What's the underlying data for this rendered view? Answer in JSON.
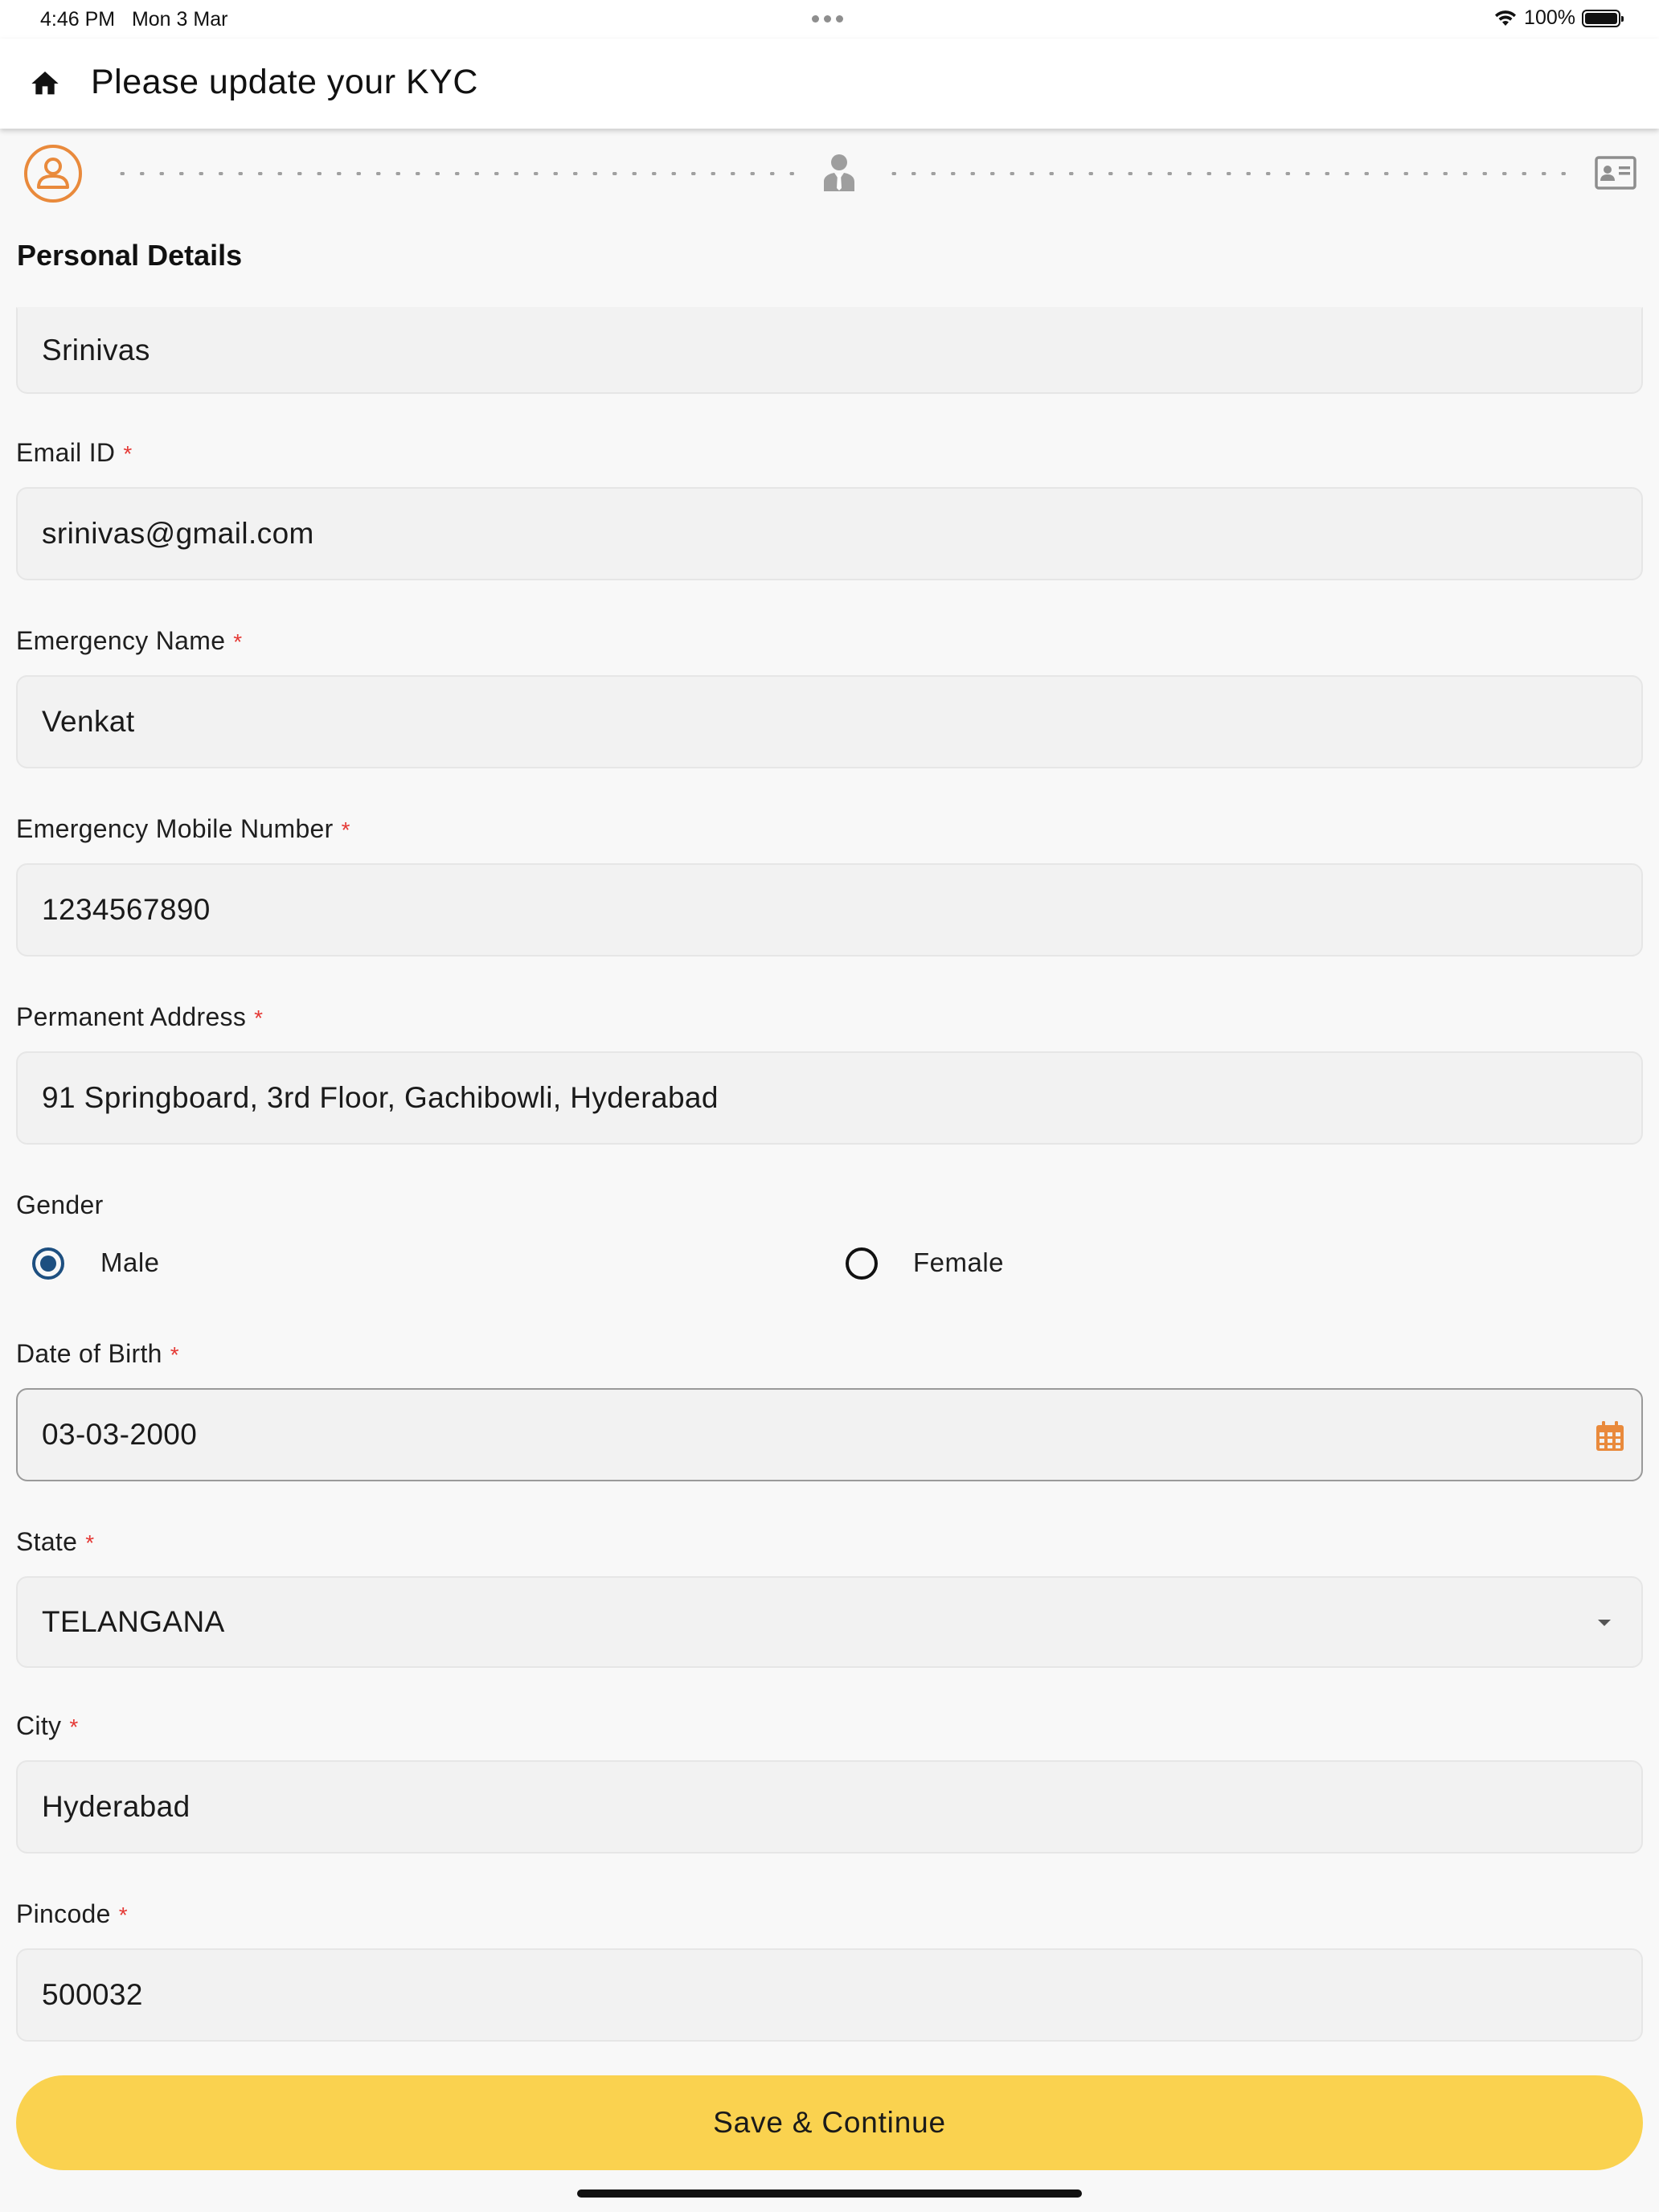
{
  "status_bar": {
    "time": "4:46 PM",
    "date": "Mon 3 Mar",
    "battery": "100%"
  },
  "header": {
    "title": "Please update your KYC"
  },
  "stepper": {
    "steps": [
      "person-icon",
      "employee-icon",
      "id-card-icon"
    ],
    "active_color": "#e98a3c",
    "inactive_color": "#9e9e9e"
  },
  "section": {
    "title": "Personal Details"
  },
  "form": {
    "name_value": "Srinivas",
    "email": {
      "label": "Email ID",
      "value": "srinivas@gmail.com"
    },
    "emergency_name": {
      "label": "Emergency Name",
      "value": "Venkat"
    },
    "emergency_mobile": {
      "label": "Emergency Mobile Number",
      "value": "1234567890"
    },
    "permanent_address": {
      "label": "Permanent Address",
      "value": "91 Springboard, 3rd Floor, Gachibowli, Hyderabad"
    },
    "gender": {
      "label": "Gender",
      "options": [
        "Male",
        "Female"
      ],
      "selected": "Male"
    },
    "dob": {
      "label": "Date of Birth",
      "value": "03-03-2000"
    },
    "state": {
      "label": "State",
      "value": "TELANGANA"
    },
    "city": {
      "label": "City",
      "value": "Hyderabad"
    },
    "pincode": {
      "label": "Pincode",
      "value": "500032"
    },
    "required_marker": "*"
  },
  "actions": {
    "save_label": "Save & Continue"
  },
  "colors": {
    "accent": "#e98a3c",
    "button": "#fad24f",
    "radio_selected": "#1d4f80",
    "required": "#e53935"
  }
}
